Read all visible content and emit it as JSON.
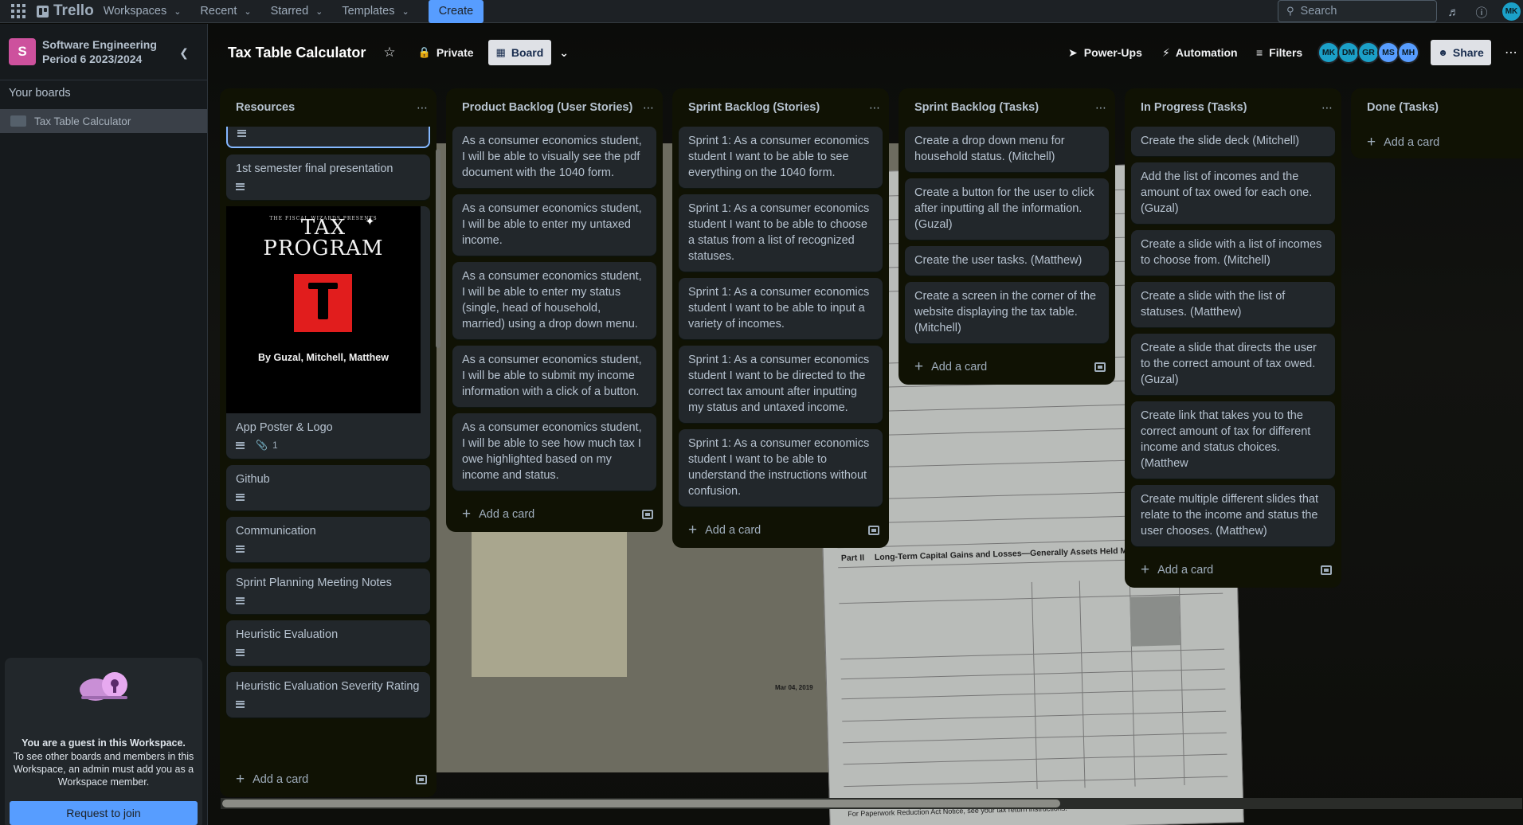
{
  "topbar": {
    "logo": "Trello",
    "menus": [
      "Workspaces",
      "Recent",
      "Starred",
      "Templates"
    ],
    "create": "Create",
    "search_placeholder": "Search",
    "avatar": "MK"
  },
  "sidebar": {
    "workspace_badge": "S",
    "workspace_name": "Software Engineering Period 6 2023/2024",
    "your_boards": "Your boards",
    "board": "Tax Table Calculator",
    "guest_title": "You are a guest in this Workspace.",
    "guest_text": "To see other boards and members in this Workspace, an admin must add you as a Workspace member.",
    "request_button": "Request to join"
  },
  "board": {
    "title": "Tax Table Calculator",
    "visibility": "Private",
    "view": "Board",
    "power_ups": "Power-Ups",
    "automation": "Automation",
    "filters": "Filters",
    "share": "Share",
    "members": [
      {
        "initials": "MK",
        "color": "#1ba0c8"
      },
      {
        "initials": "DM",
        "color": "#1ba0c8"
      },
      {
        "initials": "GR",
        "color": "#1ba0c8"
      },
      {
        "initials": "MS",
        "color": "#579dff"
      },
      {
        "initials": "MH",
        "color": "#579dff"
      }
    ]
  },
  "lists": {
    "resources": {
      "title": "Resources",
      "cards": [
        "1st semester final presentation",
        "App Poster & Logo",
        "Github",
        "Communication",
        "Sprint Planning Meeting Notes",
        "Heuristic Evaluation",
        "Heuristic Evaluation Severity Rating"
      ],
      "attachment_count": "1",
      "poster": {
        "small": "THE FISCAL WIZARDS PRESENTS",
        "title_line1": "TAX",
        "title_line2": "PROGRAM",
        "byline": "By Guzal, Mitchell, Matthew"
      }
    },
    "product_backlog": {
      "title": "Product Backlog (User Stories)",
      "cards": [
        "As a consumer economics student, I will be able to visually see the pdf document with the 1040 form.",
        "As a consumer economics student, I will be able to enter my untaxed income.",
        "As a consumer economics student, I will be able to enter my status (single, head of household, married) using a drop down menu.",
        "As a consumer economics student, I will be able to submit my income information with a click of a button.",
        "As a consumer economics student, I will be able to see how much tax I owe highlighted based on my income and status."
      ]
    },
    "sprint_stories": {
      "title": "Sprint Backlog (Stories)",
      "cards": [
        "Sprint 1: As a consumer economics student I want to be able to see everything on the 1040 form.",
        "Sprint 1: As a consumer economics student I want to be able to choose a status from a list of recognized statuses.",
        "Sprint 1: As a consumer economics student I want to be able to input a variety of incomes.",
        "Sprint 1: As a consumer economics student I want to be directed to the correct tax amount after inputting my status and untaxed income.",
        "Sprint 1: As a consumer economics student I want to be able to understand the instructions without confusion."
      ]
    },
    "sprint_tasks": {
      "title": "Sprint Backlog (Tasks)",
      "cards": [
        "Create a drop down menu for household status. (Mitchell)",
        "Create a button for the user to click after inputting all the information. (Guzal)",
        "Create the user tasks. (Matthew)",
        "Create a screen in the corner of the website displaying the tax table. (Mitchell)"
      ]
    },
    "in_progress": {
      "title": "In Progress (Tasks)",
      "cards": [
        "Create the slide deck (Mitchell)",
        "Add the list of incomes and the amount of tax owed for each one. (Guzal)",
        "Create a slide with a list of incomes to choose from. (Mitchell)",
        "Create a slide with the list of statuses. (Matthew)",
        "Create a slide that directs the user to the correct amount of tax owed. (Guzal)",
        "Create link that takes you to the correct amount of tax for different income and status choices. (Matthew",
        "Create multiple different slides that relate to the income and status the user chooses. (Matthew)"
      ]
    },
    "done": {
      "title": "Done (Tasks)",
      "cards": []
    },
    "add_card": "Add a card"
  },
  "background_form": {
    "part_label": "Part II",
    "part_title": "Long-Term Capital Gains and Losses—Generally Assets Held More Tha",
    "date_stamp": "Mar 04, 2019",
    "footer": "For Paperwork Reduction Act Notice, see your tax return instructions."
  },
  "colors": {
    "topbar": "#1d2125",
    "list_bg": "#101204",
    "card_bg": "#22272b",
    "accent": "#579dff"
  }
}
